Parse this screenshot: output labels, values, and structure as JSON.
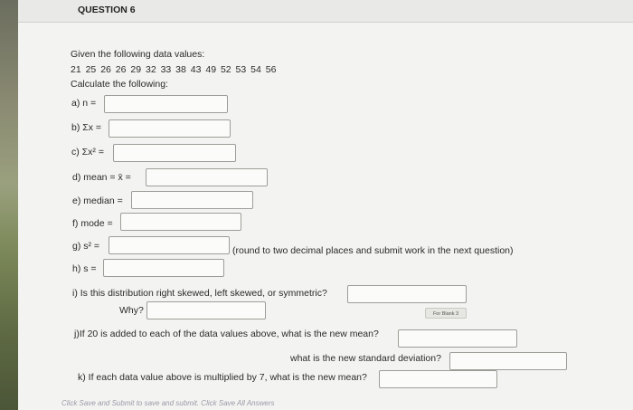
{
  "question": {
    "title": "QUESTION 6"
  },
  "intro": "Given the following data values:",
  "data_values": "21  25  26  26  29  32  33  38  43  49  52  53  54  56",
  "calculate": "Calculate the following:",
  "items": {
    "a": "a) n =",
    "b": "b) Σx =",
    "c": "c) Σx² =",
    "d": "d) mean = x̄ =",
    "e": "e) median =",
    "f": "f) mode =",
    "g": "g) s² =",
    "g_note": "(round to two decimal places and submit work in the next question)",
    "h": "h) s =",
    "i": "i) Is this distribution right skewed, left skewed, or symmetric?",
    "why": "Why?",
    "j": "j)If 20 is added to each of the data values above, what is the new mean?",
    "j2": "what is the new standard deviation?",
    "k": "k) If each data value above is multiplied by 7, what is the new mean?"
  },
  "badge": "For Blank 3",
  "footer": "Click Save and Submit to save and submit. Click Save All Answers"
}
